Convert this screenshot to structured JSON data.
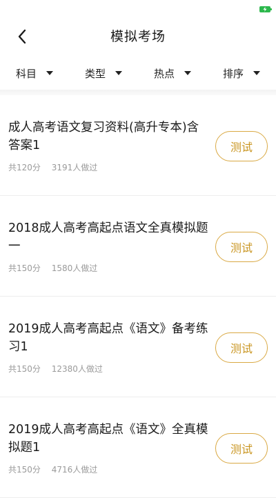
{
  "header": {
    "title": "模拟考场"
  },
  "filters": [
    {
      "label": "科目"
    },
    {
      "label": "类型"
    },
    {
      "label": "热点"
    },
    {
      "label": "排序"
    }
  ],
  "exams": [
    {
      "title": "成人高考语文复习资料(高升专本)含答案1",
      "score": "共120分",
      "count": "3191人做过",
      "button": "测试"
    },
    {
      "title": "2018成人高考高起点语文全真模拟题一",
      "score": "共150分",
      "count": "1580人做过",
      "button": "测试"
    },
    {
      "title": "2019成人高考高起点《语文》备考练习1",
      "score": "共150分",
      "count": "12380人做过",
      "button": "测试"
    },
    {
      "title": "2019成人高考高起点《语文》全真模拟题1",
      "score": "共150分",
      "count": "4716人做过",
      "button": "测试"
    }
  ],
  "colors": {
    "accent": "#d9a842",
    "accent_text": "#c99520",
    "battery": "#2db84d",
    "meta_text": "#9a9a9a"
  },
  "icons": {
    "back": "chevron-left-icon",
    "battery": "battery-charging-icon",
    "caret": "caret-down-icon"
  }
}
